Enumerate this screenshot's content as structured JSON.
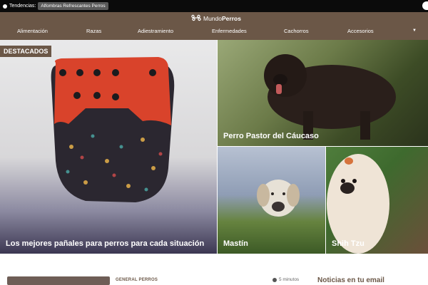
{
  "topbar": {
    "trending_label": "Tendencias:",
    "trending_chip": "Alfombras Refrescantes Perros"
  },
  "header": {
    "logo_regular": "Mundo",
    "logo_bold": "Perros"
  },
  "nav": {
    "items": [
      "Alimentación",
      "Razas",
      "Adiestramiento",
      "Enfermedades",
      "Cachorros",
      "Accesorios"
    ],
    "more_icon": "chevron-down-icon"
  },
  "featured": {
    "badge": "DESTACADOS",
    "main_title": "Los mejores pañales para perros para cada situación",
    "tiles": [
      {
        "title": "Perro Pastor del Cáucaso"
      },
      {
        "title": "Mastín"
      },
      {
        "title": "Shih Tzu"
      }
    ]
  },
  "below": {
    "category": "GENERAL PERROS",
    "read_time": "5 minutos",
    "newsletter_title": "Noticias en tu email"
  },
  "colors": {
    "header_brown": "#6b5747",
    "topbar_black": "#0b0b0b"
  }
}
